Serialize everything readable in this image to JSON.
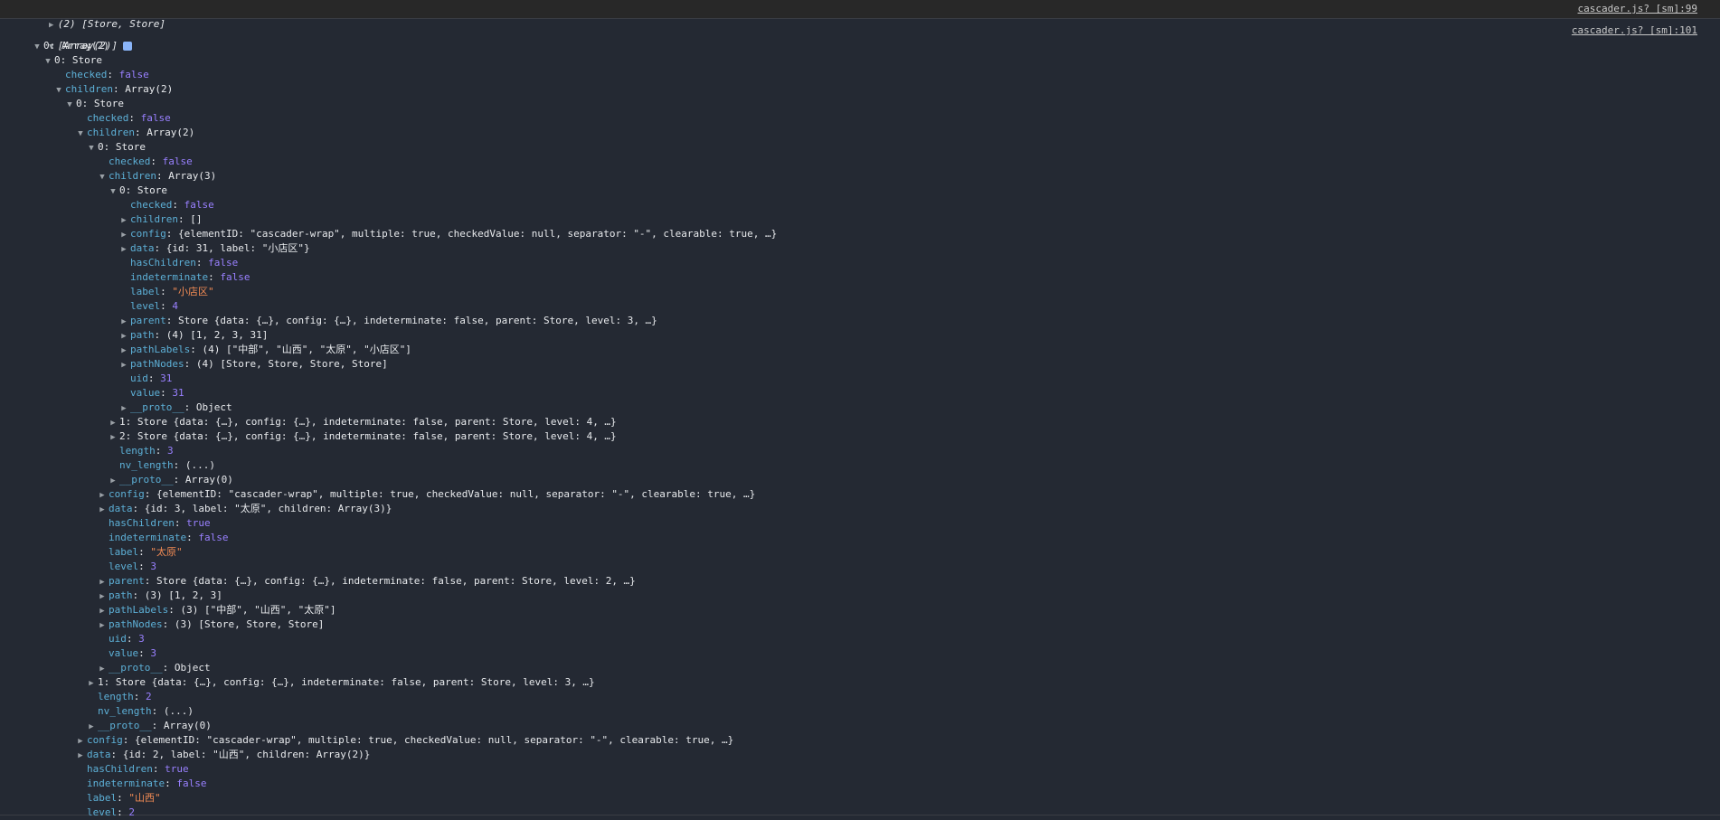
{
  "first_message": {
    "summary": "(2) [Store, Store]",
    "source": "cascader.js? [sm]:99"
  },
  "second_message": {
    "summary": "[Array(2)]",
    "source": "cascader.js? [sm]:101",
    "rows": [
      {
        "indent": 1,
        "tri": "down",
        "key": "0",
        "keyType": "idx",
        "value": "Array(2)",
        "valueType": "obj"
      },
      {
        "indent": 2,
        "tri": "down",
        "key": "0",
        "keyType": "idx",
        "value": "Store",
        "valueType": "obj"
      },
      {
        "indent": 3,
        "tri": "",
        "key": "checked",
        "keyType": "prop",
        "value": "false",
        "valueType": "bool"
      },
      {
        "indent": 3,
        "tri": "down",
        "key": "children",
        "keyType": "prop",
        "value": "Array(2)",
        "valueType": "obj"
      },
      {
        "indent": 4,
        "tri": "down",
        "key": "0",
        "keyType": "idx",
        "value": "Store",
        "valueType": "obj"
      },
      {
        "indent": 5,
        "tri": "",
        "key": "checked",
        "keyType": "prop",
        "value": "false",
        "valueType": "bool"
      },
      {
        "indent": 5,
        "tri": "down",
        "key": "children",
        "keyType": "prop",
        "value": "Array(2)",
        "valueType": "obj"
      },
      {
        "indent": 6,
        "tri": "down",
        "key": "0",
        "keyType": "idx",
        "value": "Store",
        "valueType": "obj"
      },
      {
        "indent": 7,
        "tri": "",
        "key": "checked",
        "keyType": "prop",
        "value": "false",
        "valueType": "bool"
      },
      {
        "indent": 7,
        "tri": "down",
        "key": "children",
        "keyType": "prop",
        "value": "Array(3)",
        "valueType": "obj"
      },
      {
        "indent": 8,
        "tri": "down",
        "key": "0",
        "keyType": "idx",
        "value": "Store",
        "valueType": "obj"
      },
      {
        "indent": 9,
        "tri": "",
        "key": "checked",
        "keyType": "prop",
        "value": "false",
        "valueType": "bool"
      },
      {
        "indent": 9,
        "tri": "right",
        "key": "children",
        "keyType": "prop",
        "value": "[]",
        "valueType": "obj"
      },
      {
        "indent": 9,
        "tri": "right",
        "key": "config",
        "keyType": "prop",
        "value": "{elementID: \"cascader-wrap\", multiple: true, checkedValue: null, separator: \"-\", clearable: true, …}",
        "valueType": "obj"
      },
      {
        "indent": 9,
        "tri": "right",
        "key": "data",
        "keyType": "prop",
        "value": "{id: 31, label: \"小店区\"}",
        "valueType": "obj"
      },
      {
        "indent": 9,
        "tri": "",
        "key": "hasChildren",
        "keyType": "prop",
        "value": "false",
        "valueType": "bool"
      },
      {
        "indent": 9,
        "tri": "",
        "key": "indeterminate",
        "keyType": "prop",
        "value": "false",
        "valueType": "bool"
      },
      {
        "indent": 9,
        "tri": "",
        "key": "label",
        "keyType": "prop",
        "value": "\"小店区\"",
        "valueType": "str"
      },
      {
        "indent": 9,
        "tri": "",
        "key": "level",
        "keyType": "prop",
        "value": "4",
        "valueType": "num"
      },
      {
        "indent": 9,
        "tri": "right",
        "key": "parent",
        "keyType": "prop",
        "value": "Store {data: {…}, config: {…}, indeterminate: false, parent: Store, level: 3, …}",
        "valueType": "obj"
      },
      {
        "indent": 9,
        "tri": "right",
        "key": "path",
        "keyType": "prop",
        "value": "(4) [1, 2, 3, 31]",
        "valueType": "obj"
      },
      {
        "indent": 9,
        "tri": "right",
        "key": "pathLabels",
        "keyType": "prop",
        "value": "(4) [\"中部\", \"山西\", \"太原\", \"小店区\"]",
        "valueType": "obj"
      },
      {
        "indent": 9,
        "tri": "right",
        "key": "pathNodes",
        "keyType": "prop",
        "value": "(4) [Store, Store, Store, Store]",
        "valueType": "obj"
      },
      {
        "indent": 9,
        "tri": "",
        "key": "uid",
        "keyType": "prop",
        "value": "31",
        "valueType": "num"
      },
      {
        "indent": 9,
        "tri": "",
        "key": "value",
        "keyType": "prop",
        "value": "31",
        "valueType": "num"
      },
      {
        "indent": 9,
        "tri": "right",
        "key": "__proto__",
        "keyType": "prop",
        "value": "Object",
        "valueType": "obj"
      },
      {
        "indent": 8,
        "tri": "right",
        "key": "1",
        "keyType": "idx",
        "value": "Store {data: {…}, config: {…}, indeterminate: false, parent: Store, level: 4, …}",
        "valueType": "obj"
      },
      {
        "indent": 8,
        "tri": "right",
        "key": "2",
        "keyType": "idx",
        "value": "Store {data: {…}, config: {…}, indeterminate: false, parent: Store, level: 4, …}",
        "valueType": "obj"
      },
      {
        "indent": 8,
        "tri": "",
        "key": "length",
        "keyType": "prop",
        "value": "3",
        "valueType": "num"
      },
      {
        "indent": 8,
        "tri": "",
        "key": "nv_length",
        "keyType": "prop",
        "value": "(...)",
        "valueType": "obj"
      },
      {
        "indent": 8,
        "tri": "right",
        "key": "__proto__",
        "keyType": "prop",
        "value": "Array(0)",
        "valueType": "obj"
      },
      {
        "indent": 7,
        "tri": "right",
        "key": "config",
        "keyType": "prop",
        "value": "{elementID: \"cascader-wrap\", multiple: true, checkedValue: null, separator: \"-\", clearable: true, …}",
        "valueType": "obj"
      },
      {
        "indent": 7,
        "tri": "right",
        "key": "data",
        "keyType": "prop",
        "value": "{id: 3, label: \"太原\", children: Array(3)}",
        "valueType": "obj"
      },
      {
        "indent": 7,
        "tri": "",
        "key": "hasChildren",
        "keyType": "prop",
        "value": "true",
        "valueType": "bool"
      },
      {
        "indent": 7,
        "tri": "",
        "key": "indeterminate",
        "keyType": "prop",
        "value": "false",
        "valueType": "bool"
      },
      {
        "indent": 7,
        "tri": "",
        "key": "label",
        "keyType": "prop",
        "value": "\"太原\"",
        "valueType": "str"
      },
      {
        "indent": 7,
        "tri": "",
        "key": "level",
        "keyType": "prop",
        "value": "3",
        "valueType": "num"
      },
      {
        "indent": 7,
        "tri": "right",
        "key": "parent",
        "keyType": "prop",
        "value": "Store {data: {…}, config: {…}, indeterminate: false, parent: Store, level: 2, …}",
        "valueType": "obj"
      },
      {
        "indent": 7,
        "tri": "right",
        "key": "path",
        "keyType": "prop",
        "value": "(3) [1, 2, 3]",
        "valueType": "obj"
      },
      {
        "indent": 7,
        "tri": "right",
        "key": "pathLabels",
        "keyType": "prop",
        "value": "(3) [\"中部\", \"山西\", \"太原\"]",
        "valueType": "obj"
      },
      {
        "indent": 7,
        "tri": "right",
        "key": "pathNodes",
        "keyType": "prop",
        "value": "(3) [Store, Store, Store]",
        "valueType": "obj"
      },
      {
        "indent": 7,
        "tri": "",
        "key": "uid",
        "keyType": "prop",
        "value": "3",
        "valueType": "num"
      },
      {
        "indent": 7,
        "tri": "",
        "key": "value",
        "keyType": "prop",
        "value": "3",
        "valueType": "num"
      },
      {
        "indent": 7,
        "tri": "right",
        "key": "__proto__",
        "keyType": "prop",
        "value": "Object",
        "valueType": "obj"
      },
      {
        "indent": 6,
        "tri": "right",
        "key": "1",
        "keyType": "idx",
        "value": "Store {data: {…}, config: {…}, indeterminate: false, parent: Store, level: 3, …}",
        "valueType": "obj"
      },
      {
        "indent": 6,
        "tri": "",
        "key": "length",
        "keyType": "prop",
        "value": "2",
        "valueType": "num"
      },
      {
        "indent": 6,
        "tri": "",
        "key": "nv_length",
        "keyType": "prop",
        "value": "(...)",
        "valueType": "obj"
      },
      {
        "indent": 6,
        "tri": "right",
        "key": "__proto__",
        "keyType": "prop",
        "value": "Array(0)",
        "valueType": "obj"
      },
      {
        "indent": 5,
        "tri": "right",
        "key": "config",
        "keyType": "prop",
        "value": "{elementID: \"cascader-wrap\", multiple: true, checkedValue: null, separator: \"-\", clearable: true, …}",
        "valueType": "obj"
      },
      {
        "indent": 5,
        "tri": "right",
        "key": "data",
        "keyType": "prop",
        "value": "{id: 2, label: \"山西\", children: Array(2)}",
        "valueType": "obj"
      },
      {
        "indent": 5,
        "tri": "",
        "key": "hasChildren",
        "keyType": "prop",
        "value": "true",
        "valueType": "bool"
      },
      {
        "indent": 5,
        "tri": "",
        "key": "indeterminate",
        "keyType": "prop",
        "value": "false",
        "valueType": "bool"
      },
      {
        "indent": 5,
        "tri": "",
        "key": "label",
        "keyType": "prop",
        "value": "\"山西\"",
        "valueType": "str"
      },
      {
        "indent": 5,
        "tri": "",
        "key": "level",
        "keyType": "prop",
        "value": "2",
        "valueType": "num"
      }
    ]
  }
}
